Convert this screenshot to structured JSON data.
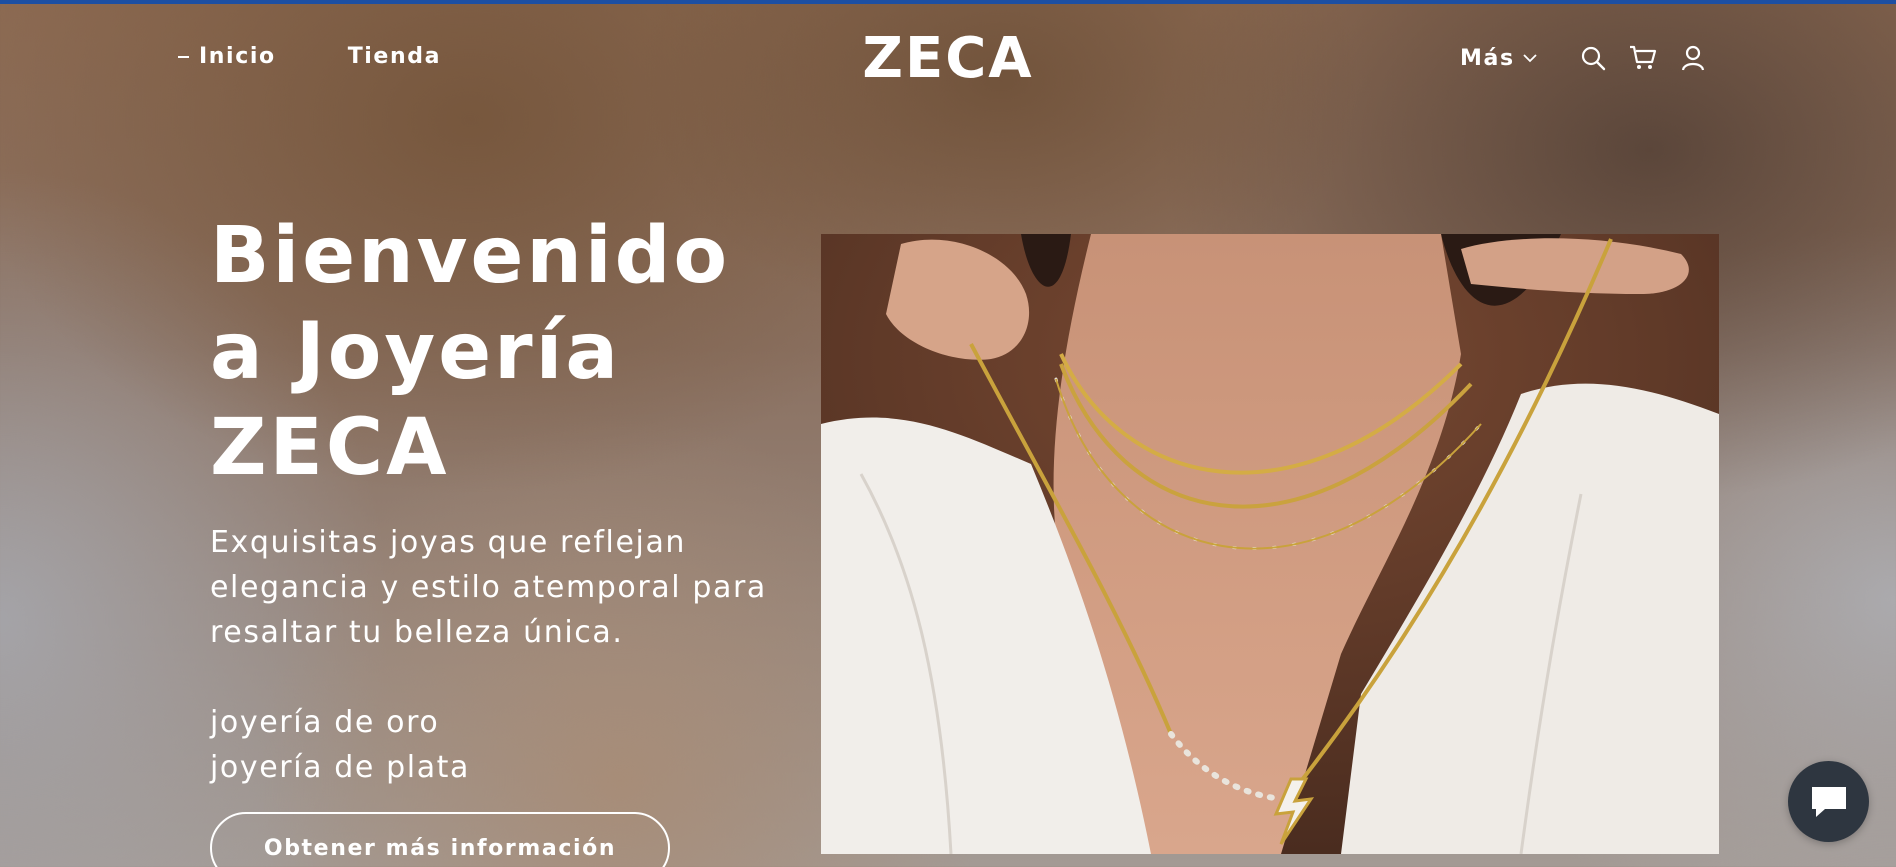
{
  "brand": {
    "logo_text": "ZECA",
    "accent_color": "#1c4fa3"
  },
  "nav": {
    "left": [
      {
        "label": "Inicio",
        "active": true
      },
      {
        "label": "Tienda",
        "active": false
      }
    ],
    "more_label": "Más",
    "icons": [
      "search-icon",
      "cart-icon",
      "account-icon"
    ]
  },
  "hero": {
    "title_line1": "Bienvenido",
    "title_line2": "a Joyería",
    "title_line3": "ZECA",
    "subtitle": "Exquisitas joyas que reflejan elegancia y estilo atemporal para resaltar tu belleza única.",
    "links": [
      "joyería de oro",
      "joyería de plata"
    ],
    "cta_label": "Obtener más información"
  },
  "chat": {
    "icon": "chat-bubble-icon",
    "color": "#2e3640"
  }
}
